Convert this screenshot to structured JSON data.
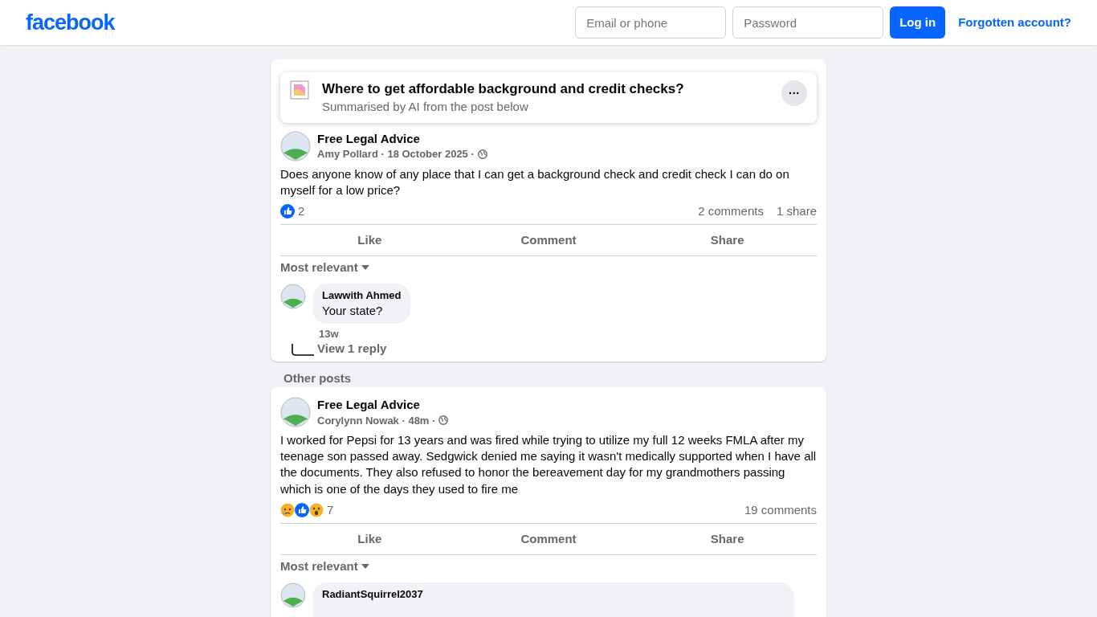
{
  "header": {
    "logo": "facebook",
    "email": {
      "placeholder": "Email or phone"
    },
    "password": {
      "placeholder": "Password"
    },
    "login": "Log in",
    "forgot": "Forgotten account?"
  },
  "summary": {
    "title": "Where to get affordable background and credit checks?",
    "subtitle": "Summarised by AI from the post below",
    "more": "···"
  },
  "posts": [
    {
      "group": "Free Legal Advice",
      "meta": "Amy Pollard · 18 October 2025 ·",
      "body": "Does anyone know of any place that I can get a background check and credit check I can do on myself for a low price?",
      "reactions": [
        {
          "kind": "like"
        }
      ],
      "reaction_count": "2",
      "comments_count": "2 comments",
      "shares_count": "1 share",
      "actions": [
        "Like",
        "Comment",
        "Share"
      ],
      "sort": "Most relevant",
      "comments": [
        {
          "name": "Lawwith Ahmed",
          "text": "Your state?",
          "time": "13w",
          "replies": "View 1 reply"
        }
      ]
    },
    {
      "section": "Other posts",
      "group": "Free Legal Advice",
      "meta": "Corylynn Nowak · 48m ·",
      "body": "I worked for Pepsi for 13 years and was fired while trying to utilize my full 12 weeks FMLA after my teenage son passed away.  Sedgwick denied me saying it wasn't medically supported when I have all the documents.  They also refused to honor the bereavement day for my grandmothers passing which is one of the days they used to fire me",
      "reactions": [
        {
          "kind": "sad"
        },
        {
          "kind": "like"
        },
        {
          "kind": "wow"
        }
      ],
      "reaction_count": "7",
      "comments_count": "19 comments",
      "actions": [
        "Like",
        "Comment",
        "Share"
      ],
      "sort": "Most relevant",
      "comments": [
        {
          "name": "RadiantSquirrel2037"
        }
      ]
    }
  ]
}
